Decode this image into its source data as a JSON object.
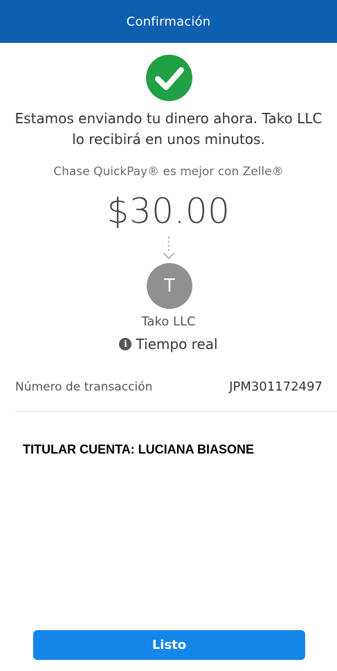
{
  "header": {
    "title": "Confirmación"
  },
  "status": {
    "icon": "check-circle-icon",
    "color": "#22a045"
  },
  "message": {
    "line1": "Estamos enviando tu dinero ahora. Tako LLC",
    "line2": "lo recibirá en unos minutos."
  },
  "subtitle": "Chase QuickPay® es mejor con Zelle®",
  "amount": "$30.00",
  "recipient": {
    "initial": "T",
    "name": "Tako LLC"
  },
  "delivery": {
    "icon": "info-icon",
    "label": "Tiempo real"
  },
  "transaction": {
    "label": "Número de transacción",
    "value": "JPM301172497"
  },
  "account_holder": "TITULAR CUENTA: LUCIANA BIASONE",
  "done_button": {
    "label": "Listo"
  },
  "colors": {
    "header": "#0f5fb1",
    "button": "#1487e8",
    "success": "#22a045",
    "avatar": "#909090"
  }
}
